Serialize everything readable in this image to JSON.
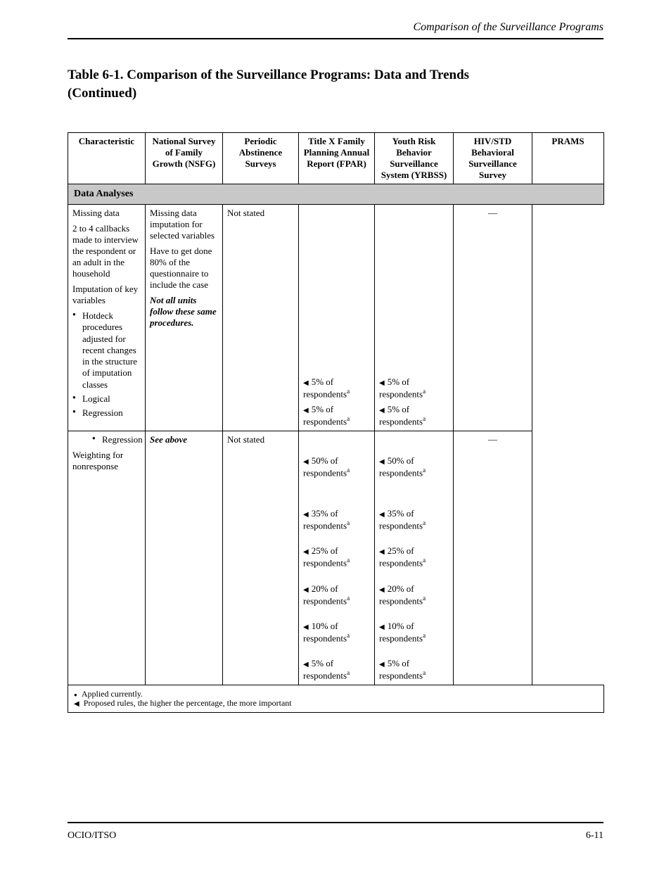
{
  "header": {
    "right": "Comparison of the Surveillance Programs"
  },
  "title": {
    "line1": "Table 6-1. Comparison of the Surveillance Programs: Data and Trends",
    "line2": "(Continued)"
  },
  "columns": [
    "Characteristic",
    "National Survey of Family Growth (NSFG)",
    "Periodic Abstinence Surveys",
    "Title X Family Planning Annual Report (FPAR)",
    "Youth Risk Behavior Surveillance System (YRBSS)",
    "HIV/STD Behavioral Surveillance Survey",
    "PRAMS"
  ],
  "section_label": "Data Analyses",
  "row1": {
    "label": "Missing data",
    "c1": {
      "p1": "2 to 4 callbacks made to interview the respondent or an adult in the household",
      "p2": "Imputation of key variables",
      "b1": "Hotdeck procedures adjusted for recent changes in the structure of imputation classes",
      "b2": "Logical",
      "b3": "Regression"
    },
    "c2": {
      "p1": "Missing data imputation for selected variables",
      "p2": "Have to get done 80% of the questionnaire to include the case",
      "p3_bold": "Not all units follow these same procedures."
    },
    "c3": "Not stated",
    "c4": "5% of respondents",
    "c5": "5% of respondents",
    "c6": "—"
  },
  "row2": {
    "bullet": "Regression",
    "c1": "Weighting for nonresponse",
    "c2_bold": "See above",
    "c3": "Not stated",
    "c4": {
      "a": "50% of respondents",
      "b": "35% of respondents",
      "c": "25% of respondents",
      "d": "20% of respondents",
      "e": "10% of respondents",
      "f": "5% of respondents"
    },
    "c5": {
      "a": "50% of respondents",
      "b": "35% of respondents",
      "c": "25% of respondents",
      "d": "20% of respondents",
      "e": "10% of respondents",
      "f": "5% of respondents"
    },
    "c6": "—"
  },
  "footnotes": {
    "bullet": "Applied currently.",
    "triangle": "Proposed rules, the higher the percentage, the more important"
  },
  "footer": {
    "left": "OCIO/ITSO",
    "right": "6-11"
  }
}
